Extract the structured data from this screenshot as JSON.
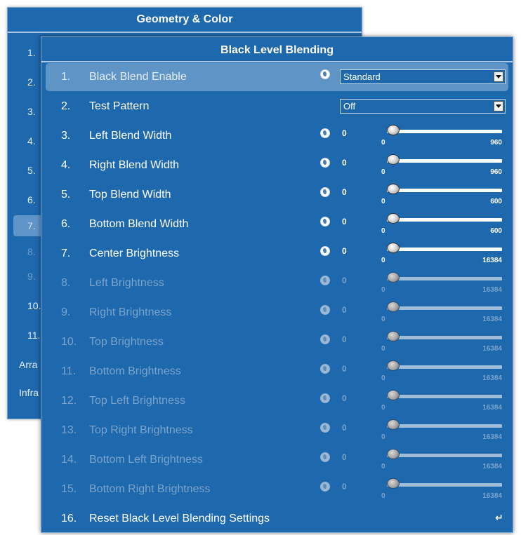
{
  "background_menu": {
    "title": "Geometry & Color",
    "items": [
      "1.",
      "2.",
      "3.",
      "4.",
      "5.",
      "6.",
      "7.",
      "8.",
      "9.",
      "10.",
      "11.",
      "Arra",
      "Infra"
    ]
  },
  "main_menu": {
    "title": "Black Level Blending",
    "rows": [
      {
        "num": "1.",
        "label": "Black Blend Enable",
        "control": "select",
        "value": "Standard"
      },
      {
        "num": "2.",
        "label": "Test Pattern",
        "control": "select",
        "value": "Off"
      },
      {
        "num": "3.",
        "label": "Left Blend Width",
        "control": "slider",
        "value": "0",
        "min": "0",
        "max": "960"
      },
      {
        "num": "4.",
        "label": "Right Blend Width",
        "control": "slider",
        "value": "0",
        "min": "0",
        "max": "960"
      },
      {
        "num": "5.",
        "label": "Top Blend Width",
        "control": "slider",
        "value": "0",
        "min": "0",
        "max": "600"
      },
      {
        "num": "6.",
        "label": "Bottom Blend Width",
        "control": "slider",
        "value": "0",
        "min": "0",
        "max": "600"
      },
      {
        "num": "7.",
        "label": "Center Brightness",
        "control": "slider",
        "value": "0",
        "min": "0",
        "max": "16384"
      },
      {
        "num": "8.",
        "label": "Left Brightness",
        "control": "slider",
        "value": "0",
        "min": "0",
        "max": "16384"
      },
      {
        "num": "9.",
        "label": "Right Brightness",
        "control": "slider",
        "value": "0",
        "min": "0",
        "max": "16384"
      },
      {
        "num": "10.",
        "label": "Top Brightness",
        "control": "slider",
        "value": "0",
        "min": "0",
        "max": "16384"
      },
      {
        "num": "11.",
        "label": "Bottom Brightness",
        "control": "slider",
        "value": "0",
        "min": "0",
        "max": "16384"
      },
      {
        "num": "12.",
        "label": "Top Left Brightness",
        "control": "slider",
        "value": "0",
        "min": "0",
        "max": "16384"
      },
      {
        "num": "13.",
        "label": "Top Right Brightness",
        "control": "slider",
        "value": "0",
        "min": "0",
        "max": "16384"
      },
      {
        "num": "14.",
        "label": "Bottom Left Brightness",
        "control": "slider",
        "value": "0",
        "min": "0",
        "max": "16384"
      },
      {
        "num": "15.",
        "label": "Bottom Right Brightness",
        "control": "slider",
        "value": "0",
        "min": "0",
        "max": "16384"
      },
      {
        "num": "16.",
        "label": "Reset Black Level Blending Settings",
        "control": "action",
        "icon": "enter-icon"
      }
    ]
  },
  "colors": {
    "panel_bg": "#1e68ad",
    "selected_row": "#5f94c6",
    "disabled_text": "#7aa4cc",
    "text": "#ffffff"
  }
}
